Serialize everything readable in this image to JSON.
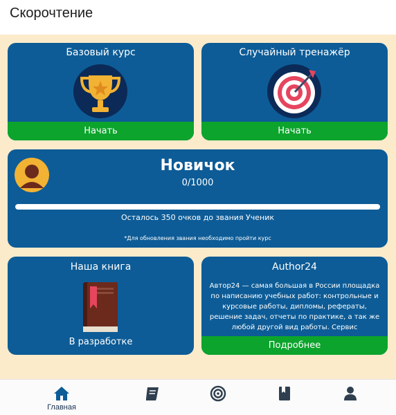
{
  "app": {
    "title": "Скорочтение"
  },
  "cards": {
    "base_course": {
      "title": "Базовый курс",
      "action": "Начать",
      "icon": "trophy-icon"
    },
    "random_trainer": {
      "title": "Случайный тренажёр",
      "action": "Начать",
      "icon": "target-icon"
    },
    "rank": {
      "title": "Новичок",
      "score": "0/1000",
      "progress": 0,
      "next_rank_text": "Осталось 350 очков до звания Ученик",
      "note": "*Для обновления звания необходимо пройти курс",
      "icon": "avatar-icon"
    },
    "book": {
      "title": "Наша книга",
      "status": "В разработке",
      "icon": "book-icon"
    },
    "author24": {
      "title": "Author24",
      "text": "Автор24 — самая большая в России площадка по написанию учебных работ: контрольные и курсовые работы, дипломы, рефераты, решение задач, отчеты по практике, а так же любой другой вид работы. Сервис",
      "action": "Подробнее"
    }
  },
  "nav": {
    "items": [
      {
        "label": "Главная",
        "icon": "home-icon",
        "active": true
      },
      {
        "label": "",
        "icon": "book-icon"
      },
      {
        "label": "",
        "icon": "target-icon"
      },
      {
        "label": "",
        "icon": "bookmark-book-icon"
      },
      {
        "label": "",
        "icon": "profile-icon"
      }
    ]
  },
  "colors": {
    "card_blue": "#0d5c97",
    "action_green": "#0ca42c",
    "page_bg": "#fbebcb",
    "nav_active": "#0d5c97",
    "nav_inactive": "#2f3f4f"
  }
}
